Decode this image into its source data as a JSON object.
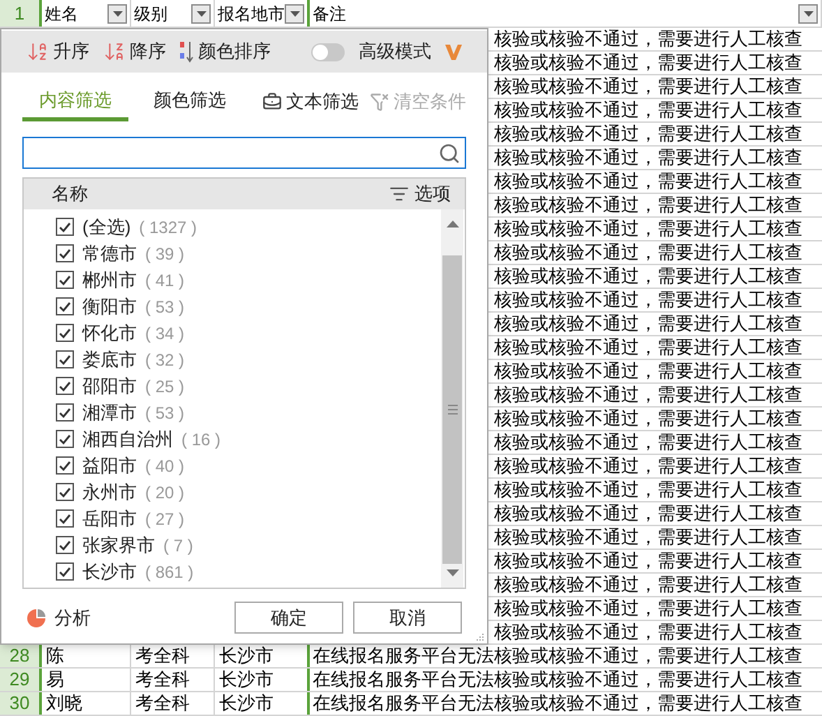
{
  "header": {
    "row_number": "1",
    "columns": [
      {
        "label": "姓名"
      },
      {
        "label": "级别"
      },
      {
        "label": "报名地市"
      },
      {
        "label": "备注"
      }
    ]
  },
  "rows_behind_popup": [
    {
      "note": "核验或核验不通过，需要进行人工核查"
    },
    {
      "note": "核验或核验不通过，需要进行人工核查"
    },
    {
      "note": "核验或核验不通过，需要进行人工核查"
    },
    {
      "note": "核验或核验不通过，需要进行人工核查"
    },
    {
      "note": "核验或核验不通过，需要进行人工核查"
    },
    {
      "note": "核验或核验不通过，需要进行人工核查"
    },
    {
      "note": "核验或核验不通过，需要进行人工核查"
    },
    {
      "note": "核验或核验不通过，需要进行人工核查"
    },
    {
      "note": "核验或核验不通过，需要进行人工核查"
    },
    {
      "note": "核验或核验不通过，需要进行人工核查"
    },
    {
      "note": "核验或核验不通过，需要进行人工核查"
    },
    {
      "note": "核验或核验不通过，需要进行人工核查"
    },
    {
      "note": "核验或核验不通过，需要进行人工核查"
    },
    {
      "note": "核验或核验不通过，需要进行人工核查"
    },
    {
      "note": "核验或核验不通过，需要进行人工核查"
    },
    {
      "note": "核验或核验不通过，需要进行人工核查"
    },
    {
      "note": "核验或核验不通过，需要进行人工核查"
    },
    {
      "note": "核验或核验不通过，需要进行人工核查"
    },
    {
      "note": "核验或核验不通过，需要进行人工核查"
    },
    {
      "note": "核验或核验不通过，需要进行人工核查"
    },
    {
      "note": "核验或核验不通过，需要进行人工核查"
    },
    {
      "note": "核验或核验不通过，需要进行人工核查"
    },
    {
      "note": "核验或核验不通过，需要进行人工核查"
    },
    {
      "note": "核验或核验不通过，需要进行人工核查"
    },
    {
      "note": "核验或核验不通过，需要进行人工核查"
    },
    {
      "note": "核验或核验不通过，需要进行人工核查"
    }
  ],
  "rows": [
    {
      "number": "28",
      "name": "陈",
      "level": "考全科",
      "city": "长沙市",
      "note": "在线报名服务平台无法核验或核验不通过，需要进行人工核查"
    },
    {
      "number": "29",
      "name": "易",
      "level": "考全科",
      "city": "长沙市",
      "note": "在线报名服务平台无法核验或核验不通过，需要进行人工核查"
    },
    {
      "number": "30",
      "name": "刘晓",
      "level": "考全科",
      "city": "长沙市",
      "note": "在线报名服务平台无法核验或核验不通过，需要进行人工核查"
    }
  ],
  "filter_popup": {
    "sort_buttons": [
      {
        "kind": "ascending",
        "label": "升序"
      },
      {
        "kind": "descending",
        "label": "降序"
      },
      {
        "kind": "color",
        "label": "颜色排序"
      }
    ],
    "advanced_mode": {
      "label": "高级模式",
      "on": false
    },
    "tabs": [
      {
        "label": "内容筛选",
        "selected": true
      },
      {
        "label": "颜色筛选",
        "selected": false
      }
    ],
    "actions": [
      {
        "kind": "text",
        "label": "文本筛选",
        "disabled": false
      },
      {
        "kind": "clear",
        "label": "清空条件",
        "disabled": true
      }
    ],
    "list": {
      "header": "名称",
      "options_label": "选项",
      "items": [
        {
          "label": "(全选)",
          "count": "( 1327 )",
          "checked": true
        },
        {
          "label": "常德市",
          "count": "( 39 )",
          "checked": true
        },
        {
          "label": "郴州市",
          "count": "( 41 )",
          "checked": true
        },
        {
          "label": "衡阳市",
          "count": "( 53 )",
          "checked": true
        },
        {
          "label": "怀化市",
          "count": "( 34 )",
          "checked": true
        },
        {
          "label": "娄底市",
          "count": "( 32 )",
          "checked": true
        },
        {
          "label": "邵阳市",
          "count": "( 25 )",
          "checked": true
        },
        {
          "label": "湘潭市",
          "count": "( 53 )",
          "checked": true
        },
        {
          "label": "湘西自治州",
          "count": "( 16 )",
          "checked": true
        },
        {
          "label": "益阳市",
          "count": "( 40 )",
          "checked": true
        },
        {
          "label": "永州市",
          "count": "( 20 )",
          "checked": true
        },
        {
          "label": "岳阳市",
          "count": "( 27 )",
          "checked": true
        },
        {
          "label": "张家界市",
          "count": "( 7 )",
          "checked": true
        },
        {
          "label": "长沙市",
          "count": "( 861 )",
          "checked": true
        }
      ]
    },
    "analyze_label": "分析",
    "buttons": [
      {
        "label": "确定"
      },
      {
        "label": "取消"
      }
    ]
  }
}
